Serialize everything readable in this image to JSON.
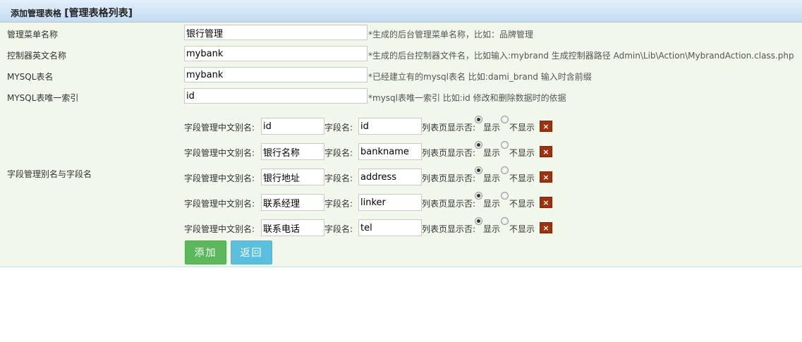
{
  "header": {
    "title": "添加管理表格",
    "subtitle": "[管理表格列表]"
  },
  "form": {
    "menu_name": {
      "label": "管理菜单名称",
      "value": "银行管理",
      "hint": "*生成的后台管理菜单名称，比如：品牌管理"
    },
    "controller_name": {
      "label": "控制器英文名称",
      "value": "mybank",
      "hint": "*生成的后台控制器文件名，比如输入:mybrand 生成控制器路径 Admin\\Lib\\Action\\MybrandAction.class.php"
    },
    "table_name": {
      "label": "MYSQL表名",
      "value": "mybank",
      "hint": "*已经建立有的mysql表名 比如:dami_brand 输入时含前缀"
    },
    "primary_key": {
      "label": "MYSQL表唯一索引",
      "value": "id",
      "hint": "*mysql表唯一索引 比如:id 修改和删除数据时的依据"
    },
    "fields_label": "字段管理别名与字段名"
  },
  "field_labels": {
    "alias": "字段管理中文别名:",
    "name": "字段名:",
    "show": "列表页显示否:",
    "yes": "显示",
    "no": "不显示",
    "delete": "×"
  },
  "fields": [
    {
      "alias": "id",
      "name": "id",
      "show": true
    },
    {
      "alias": "银行名称",
      "name": "bankname",
      "show": true
    },
    {
      "alias": "银行地址",
      "name": "address",
      "show": true
    },
    {
      "alias": "联系经理",
      "name": "linker",
      "show": true
    },
    {
      "alias": "联系电话",
      "name": "tel",
      "show": true
    }
  ],
  "buttons": {
    "add": "添加",
    "back": "返回"
  }
}
